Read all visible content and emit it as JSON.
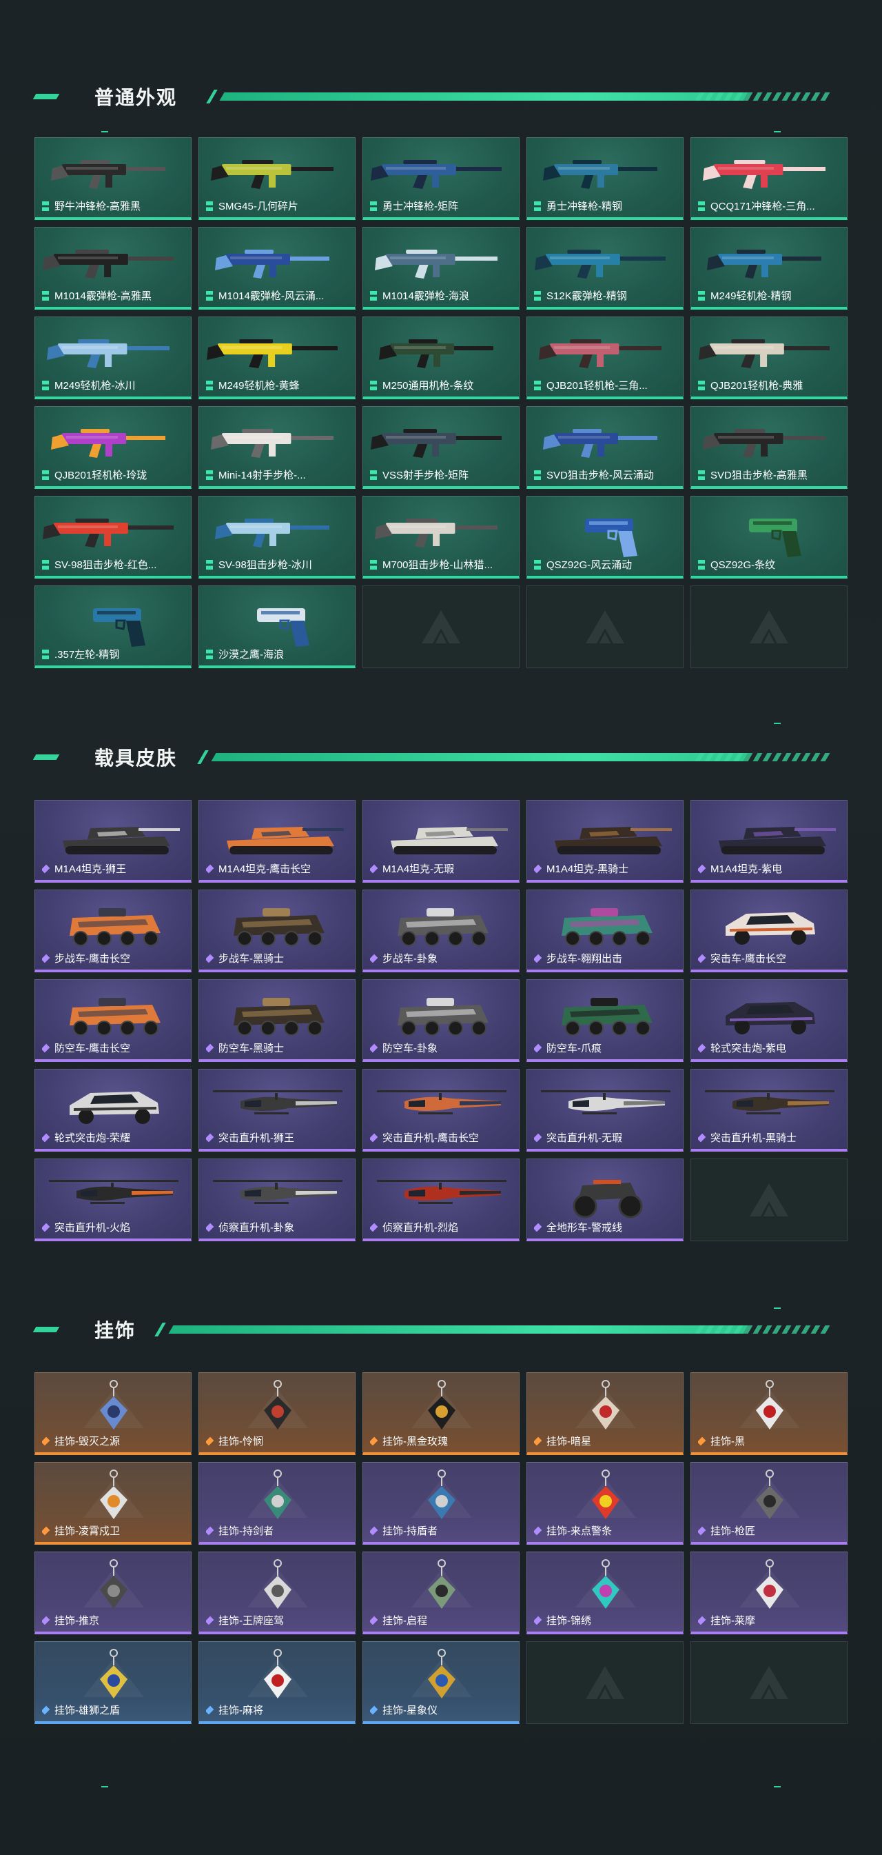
{
  "sections": {
    "weapons": {
      "title": "普通外观",
      "items": [
        {
          "label": "野牛冲锋枪-高雅黑",
          "color": "#2a2a2a",
          "accent": "#555555"
        },
        {
          "label": "SMG45-几何碎片",
          "color": "#b9c43a",
          "accent": "#1e1e1e"
        },
        {
          "label": "勇士冲锋枪-矩阵",
          "color": "#2f5f9a",
          "accent": "#1b2b45"
        },
        {
          "label": "勇士冲锋枪-精钢",
          "color": "#2d7aa0",
          "accent": "#103040"
        },
        {
          "label": "QCQ171冲锋枪-三角...",
          "color": "#e04050",
          "accent": "#f2d5d5"
        },
        {
          "label": "M1014霰弹枪-高雅黑",
          "color": "#222222",
          "accent": "#444444"
        },
        {
          "label": "M1014霰弹枪-风云涌...",
          "color": "#2a4c9c",
          "accent": "#6aa0e0"
        },
        {
          "label": "M1014霰弹枪-海浪",
          "color": "#4d6f8a",
          "accent": "#cfdfe8"
        },
        {
          "label": "S12K霰弹枪-精钢",
          "color": "#2680a8",
          "accent": "#16384a"
        },
        {
          "label": "M249轻机枪-精钢",
          "color": "#2a7fb0",
          "accent": "#1b2c3a"
        },
        {
          "label": "M249轻机枪-冰川",
          "color": "#9fc8e8",
          "accent": "#3d7bb5"
        },
        {
          "label": "M249轻机枪-黄蜂",
          "color": "#e8d020",
          "accent": "#1a1a1a"
        },
        {
          "label": "M250通用机枪-条纹",
          "color": "#2f4a32",
          "accent": "#1c1c1c"
        },
        {
          "label": "QJB201轻机枪-三角...",
          "color": "#c06070",
          "accent": "#3a2a2a"
        },
        {
          "label": "QJB201轻机枪-典雅",
          "color": "#d8d0c0",
          "accent": "#2a2a2a"
        },
        {
          "label": "QJB201轻机枪-玲珑",
          "color": "#b040c8",
          "accent": "#f0a030"
        },
        {
          "label": "Mini-14射手步枪-...",
          "color": "#e8e4e0",
          "accent": "#6a6a6a"
        },
        {
          "label": "VSS射手步枪-矩阵",
          "color": "#3a4a5a",
          "accent": "#1e1e1e"
        },
        {
          "label": "SVD狙击步枪-风云涌动",
          "color": "#2a4a9a",
          "accent": "#5a8ad0"
        },
        {
          "label": "SVD狙击步枪-高雅黑",
          "color": "#262626",
          "accent": "#4a4a4a"
        },
        {
          "label": "SV-98狙击步枪-红色...",
          "color": "#e04030",
          "accent": "#2a2a2a"
        },
        {
          "label": "SV-98狙击步枪-冰川",
          "color": "#a8cfe8",
          "accent": "#2f6fa8"
        },
        {
          "label": "M700狙击步枪-山林猎...",
          "color": "#d8d4cc",
          "accent": "#555555"
        },
        {
          "label": "QSZ92G-风云涌动",
          "color": "#2a5ab0",
          "accent": "#7aa8e8"
        },
        {
          "label": "QSZ92G-条纹",
          "color": "#3aa060",
          "accent": "#1f4a2a"
        },
        {
          "label": ".357左轮-精钢",
          "color": "#2a78a8",
          "accent": "#12303f"
        },
        {
          "label": "沙漠之鹰-海浪",
          "color": "#d8e4ee",
          "accent": "#2a5a9a"
        }
      ],
      "empty_slots": 3
    },
    "vehicles": {
      "title": "载具皮肤",
      "items": [
        {
          "label": "M1A4坦克-狮王",
          "kind": "tank",
          "color": "#3a3a3a",
          "accent": "#d0d0d0"
        },
        {
          "label": "M1A4坦克-鹰击长空",
          "kind": "tank",
          "color": "#e07a3a",
          "accent": "#2a3a5a"
        },
        {
          "label": "M1A4坦克-无瑕",
          "kind": "tank",
          "color": "#d8d8d0",
          "accent": "#777777"
        },
        {
          "label": "M1A4坦克-黑骑士",
          "kind": "tank",
          "color": "#3a2e24",
          "accent": "#a07040"
        },
        {
          "label": "M1A4坦克-紫电",
          "kind": "tank",
          "color": "#2a2a3a",
          "accent": "#7a5ab0"
        },
        {
          "label": "步战车-鹰击长空",
          "kind": "apc",
          "color": "#e07a3a",
          "accent": "#3a3a4a"
        },
        {
          "label": "步战车-黑骑士",
          "kind": "apc",
          "color": "#3a3228",
          "accent": "#a08050"
        },
        {
          "label": "步战车-卦象",
          "kind": "apc",
          "color": "#5a5a5a",
          "accent": "#d8d8d8"
        },
        {
          "label": "步战车-翱翔出击",
          "kind": "apc",
          "color": "#3a8a7a",
          "accent": "#b04aa0"
        },
        {
          "label": "突击车-鹰击长空",
          "kind": "car",
          "color": "#e8e0d8",
          "accent": "#d06030"
        },
        {
          "label": "防空车-鹰击长空",
          "kind": "apc",
          "color": "#e07a3a",
          "accent": "#3a3a4a"
        },
        {
          "label": "防空车-黑骑士",
          "kind": "apc",
          "color": "#3a3228",
          "accent": "#a08050"
        },
        {
          "label": "防空车-卦象",
          "kind": "apc",
          "color": "#5a5a5a",
          "accent": "#d8d8d8"
        },
        {
          "label": "防空车-爪痕",
          "kind": "apc",
          "color": "#2f6a4a",
          "accent": "#1e1e1e"
        },
        {
          "label": "轮式突击炮-紫电",
          "kind": "car",
          "color": "#2a2a3a",
          "accent": "#7a5ab0"
        },
        {
          "label": "轮式突击炮-荣耀",
          "kind": "car",
          "color": "#d8d8d8",
          "accent": "#3a3a3a"
        },
        {
          "label": "突击直升机-狮王",
          "kind": "heli",
          "color": "#3a3a3a",
          "accent": "#c0c0c0"
        },
        {
          "label": "突击直升机-鹰击长空",
          "kind": "heli",
          "color": "#d06a3a",
          "accent": "#2a3a5a"
        },
        {
          "label": "突击直升机-无瑕",
          "kind": "heli",
          "color": "#d8d8d8",
          "accent": "#7a7a7a"
        },
        {
          "label": "突击直升机-黑骑士",
          "kind": "heli",
          "color": "#3a3228",
          "accent": "#a07040"
        },
        {
          "label": "突击直升机-火焰",
          "kind": "heli",
          "color": "#2a2a2a",
          "accent": "#e06a2a"
        },
        {
          "label": "侦察直升机-卦象",
          "kind": "heli",
          "color": "#4a4a4a",
          "accent": "#d0d0d0"
        },
        {
          "label": "侦察直升机-烈焰",
          "kind": "heli",
          "color": "#b03020",
          "accent": "#2a2a2a"
        },
        {
          "label": "全地形车-警戒线",
          "kind": "atv",
          "color": "#3a3a3a",
          "accent": "#d05020"
        }
      ],
      "empty_slots": 1
    },
    "charms": {
      "title": "挂饰",
      "items": [
        {
          "label": "挂饰-毁灭之源",
          "tier": "orange",
          "color": "#6a8ad0",
          "accent": "#2a3a6a"
        },
        {
          "label": "挂饰-怜悯",
          "tier": "orange",
          "color": "#2a2a2a",
          "accent": "#c04030"
        },
        {
          "label": "挂饰-黑金玫瑰",
          "tier": "orange",
          "color": "#1e1e1e",
          "accent": "#d8a030"
        },
        {
          "label": "挂饰-暗星",
          "tier": "orange",
          "color": "#e0d0c0",
          "accent": "#c02a2a"
        },
        {
          "label": "挂饰-黑",
          "tier": "orange",
          "color": "#e8e8e8",
          "accent": "#c02020"
        },
        {
          "label": "挂饰-凌霄戍卫",
          "tier": "orange",
          "color": "#e0e0e0",
          "accent": "#e08a2a"
        },
        {
          "label": "挂饰-持剑者",
          "tier": "purple",
          "color": "#3a8a7a",
          "accent": "#d0d0d0"
        },
        {
          "label": "挂饰-持盾者",
          "tier": "purple",
          "color": "#3a7ab0",
          "accent": "#d0d0d0"
        },
        {
          "label": "挂饰-来点警条",
          "tier": "purple",
          "color": "#e03a2a",
          "accent": "#f0d020"
        },
        {
          "label": "挂饰-枪匠",
          "tier": "purple",
          "color": "#6a6a6a",
          "accent": "#2a2a2a"
        },
        {
          "label": "挂饰-推京",
          "tier": "purple",
          "color": "#4a4a4a",
          "accent": "#8a8a8a"
        },
        {
          "label": "挂饰-王牌座驾",
          "tier": "purple",
          "color": "#d8d8d8",
          "accent": "#5a5a5a"
        },
        {
          "label": "挂饰-启程",
          "tier": "purple",
          "color": "#7a9a7a",
          "accent": "#2a2a2a"
        },
        {
          "label": "挂饰-锦绣",
          "tier": "purple",
          "color": "#30c8c0",
          "accent": "#c040b0"
        },
        {
          "label": "挂饰-莱摩",
          "tier": "purple",
          "color": "#e8e8e8",
          "accent": "#c03040"
        },
        {
          "label": "挂饰-雄狮之盾",
          "tier": "blue",
          "color": "#e0c040",
          "accent": "#2a4aa0"
        },
        {
          "label": "挂饰-麻将",
          "tier": "blue",
          "color": "#f0f0f0",
          "accent": "#c02020"
        },
        {
          "label": "挂饰-星象仪",
          "tier": "blue",
          "color": "#d0a030",
          "accent": "#2a5ab0"
        }
      ],
      "empty_slots": 2
    }
  },
  "colors": {
    "green": "#30d9a0",
    "purple": "#a97ef0",
    "orange": "#f0913a",
    "blue": "#5ea6ef"
  }
}
